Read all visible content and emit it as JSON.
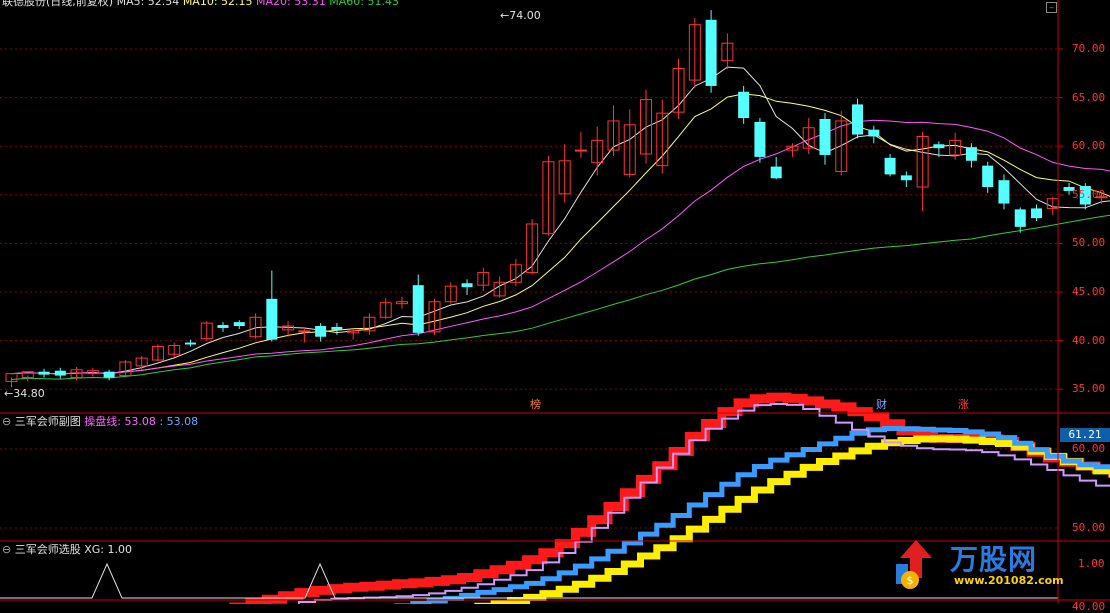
{
  "header": {
    "title": "联德股份(日线,前复权)",
    "ma5": "MA5: 52.54",
    "ma10": "MA10: 52.15",
    "ma20": "MA20: 53.31",
    "ma60": "MA60: 51.43"
  },
  "main_axis_labels": [
    "70.00",
    "65.00",
    "60.00",
    "55.00",
    "50.00",
    "45.00",
    "40.00",
    "35.00"
  ],
  "main_axis_values": [
    70,
    65,
    60,
    55,
    50,
    45,
    40,
    35
  ],
  "price_high_label": "74.00",
  "price_low_label": "34.80",
  "event_tags": [
    "榜",
    "财",
    "涨"
  ],
  "sub_panel": {
    "title": "三军会师副图",
    "line_label": "操盘线:",
    "value1": "53.08",
    "separator": ":",
    "value2": "53.08",
    "price_badge": "61.21",
    "axis_labels": [
      "60.00",
      "50.00",
      "40.00"
    ],
    "axis_values": [
      60,
      50,
      40
    ]
  },
  "signal_panel": {
    "title": "三军会师选股",
    "xg_label": "XG: 1.00",
    "axis_label": "1.00"
  },
  "logo": {
    "text": "万股网",
    "sub": "www.201082.com"
  },
  "colors": {
    "up": "#ff3333",
    "down": "#54ffff",
    "ma5": "#e0e0e0",
    "ma10": "#ffff66",
    "ma20": "#ff55ff",
    "ma60": "#33cc33",
    "grid": "#8a0000",
    "axis": "#cc0000"
  },
  "chart_data": {
    "type": "candlestick",
    "candles": [
      [
        35.8,
        36.6,
        35.2,
        36.2
      ],
      [
        36.2,
        36.8,
        35.8,
        36.4
      ],
      [
        36.8,
        36.5,
        36.2,
        37.1
      ],
      [
        36.9,
        36.4,
        36.1,
        37.2
      ],
      [
        36.2,
        37.0,
        35.9,
        37.3
      ],
      [
        36.6,
        36.9,
        36.3,
        37.2
      ],
      [
        36.8,
        36.2,
        35.9,
        37.0
      ],
      [
        36.4,
        37.8,
        36.2,
        38.0
      ],
      [
        37.4,
        38.2,
        37.0,
        38.4
      ],
      [
        38.0,
        39.4,
        37.9,
        39.6
      ],
      [
        38.6,
        39.5,
        38.3,
        39.8
      ],
      [
        39.8,
        39.6,
        39.4,
        40.1
      ],
      [
        40.2,
        41.8,
        40.0,
        42.0
      ],
      [
        41.6,
        41.3,
        40.9,
        41.9
      ],
      [
        41.9,
        41.5,
        41.2,
        42.1
      ],
      [
        40.4,
        42.4,
        40.2,
        42.8
      ],
      [
        44.3,
        40.1,
        39.9,
        47.2
      ],
      [
        41.1,
        41.5,
        40.4,
        42.0
      ],
      [
        40.9,
        41.0,
        39.8,
        41.4
      ],
      [
        41.5,
        40.4,
        39.9,
        41.8
      ],
      [
        41.4,
        41.1,
        40.6,
        41.8
      ],
      [
        40.8,
        41.0,
        40.1,
        41.2
      ],
      [
        41.0,
        42.4,
        40.6,
        42.8
      ],
      [
        42.4,
        43.9,
        42.2,
        44.4
      ],
      [
        43.8,
        44.0,
        43.3,
        44.5
      ],
      [
        45.7,
        40.8,
        40.5,
        46.8
      ],
      [
        40.9,
        44.0,
        40.6,
        44.3
      ],
      [
        44.0,
        45.6,
        43.8,
        46.0
      ],
      [
        45.9,
        45.5,
        44.7,
        46.3
      ],
      [
        45.7,
        47.0,
        45.1,
        47.5
      ],
      [
        44.6,
        46.0,
        44.4,
        46.6
      ],
      [
        46.0,
        47.8,
        45.6,
        48.4
      ],
      [
        47.0,
        52.0,
        46.8,
        52.5
      ],
      [
        51.0,
        58.4,
        50.8,
        59.0
      ],
      [
        55.1,
        58.5,
        54.2,
        60.2
      ],
      [
        59.5,
        59.6,
        58.8,
        61.5
      ],
      [
        58.3,
        60.6,
        57.0,
        62.0
      ],
      [
        59.6,
        62.6,
        59.0,
        64.2
      ],
      [
        57.1,
        62.2,
        56.8,
        63.8
      ],
      [
        59.2,
        64.8,
        58.2,
        65.8
      ],
      [
        58.0,
        63.4,
        57.2,
        64.8
      ],
      [
        63.5,
        68.0,
        62.8,
        69.0
      ],
      [
        66.8,
        72.5,
        66.0,
        73.2
      ],
      [
        73.0,
        66.2,
        65.5,
        74.0
      ],
      [
        68.8,
        70.6,
        67.9,
        71.6
      ],
      [
        65.6,
        62.9,
        62.3,
        66.2
      ],
      [
        62.5,
        58.9,
        58.3,
        62.9
      ],
      [
        57.9,
        56.7,
        56.6,
        58.9
      ],
      [
        59.6,
        60.0,
        58.9,
        60.3
      ],
      [
        59.8,
        61.9,
        59.2,
        62.9
      ],
      [
        62.8,
        59.1,
        58.1,
        63.4
      ],
      [
        57.4,
        62.6,
        57.0,
        63.6
      ],
      [
        64.3,
        61.2,
        60.8,
        64.9
      ],
      [
        61.7,
        61.0,
        60.3,
        62.1
      ],
      [
        58.8,
        57.1,
        56.9,
        59.2
      ],
      [
        57.0,
        56.5,
        55.8,
        57.4
      ],
      [
        55.8,
        61.0,
        53.3,
        61.5
      ],
      [
        60.2,
        59.8,
        58.9,
        60.5
      ],
      [
        59.1,
        60.6,
        58.6,
        61.4
      ],
      [
        59.9,
        58.5,
        57.8,
        60.3
      ],
      [
        58.0,
        55.8,
        55.2,
        58.4
      ],
      [
        56.5,
        54.1,
        53.5,
        57.1
      ],
      [
        53.5,
        51.7,
        51.1,
        53.7
      ],
      [
        53.6,
        52.6,
        52.3,
        54.0
      ],
      [
        53.6,
        54.6,
        52.9,
        54.8
      ],
      [
        55.8,
        55.4,
        55.0,
        56.2
      ],
      [
        55.9,
        54.0,
        53.5,
        56.2
      ],
      [
        54.8,
        54.8,
        54.1,
        55.3
      ],
      [
        52.6,
        53.6,
        52.3,
        54.0
      ],
      [
        52.9,
        53.5,
        52.4,
        54.0
      ],
      [
        53.8,
        49.8,
        49.5,
        54.2
      ],
      [
        52.5,
        51.4,
        50.7,
        52.9
      ],
      [
        52.7,
        49.2,
        48.7,
        52.9
      ],
      [
        49.3,
        49.3,
        48.7,
        49.9
      ],
      [
        50.3,
        48.6,
        48.1,
        50.6
      ],
      [
        49.9,
        52.6,
        49.4,
        53.1
      ],
      [
        51.0,
        51.2,
        50.6,
        52.4
      ],
      [
        54.0,
        55.1,
        53.5,
        56.1
      ],
      [
        55.7,
        59.1,
        55.3,
        59.3
      ]
    ]
  }
}
